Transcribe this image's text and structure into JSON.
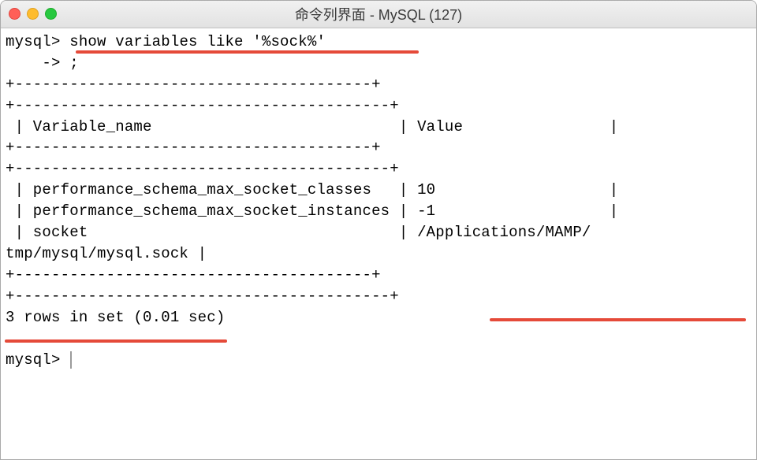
{
  "window": {
    "title": "命令列界面 - MySQL (127)"
  },
  "terminal": {
    "prompt1": "mysql> ",
    "command": "show variables like '%sock%'",
    "continuation": "    -> ;",
    "border_short": "+---------------------------------------+",
    "border_long": "+-----------------------------------------+",
    "header_row": " | Variable_name                           | Value                |",
    "row1": " | performance_schema_max_socket_classes   | 10                   |",
    "row2": " | performance_schema_max_socket_instances | -1                   |",
    "row3a": " | socket                                  | /Applications/MAMP/",
    "row3b": "tmp/mysql/mysql.sock |",
    "footer": "3 rows in set (0.01 sec)",
    "prompt2": "mysql> "
  }
}
